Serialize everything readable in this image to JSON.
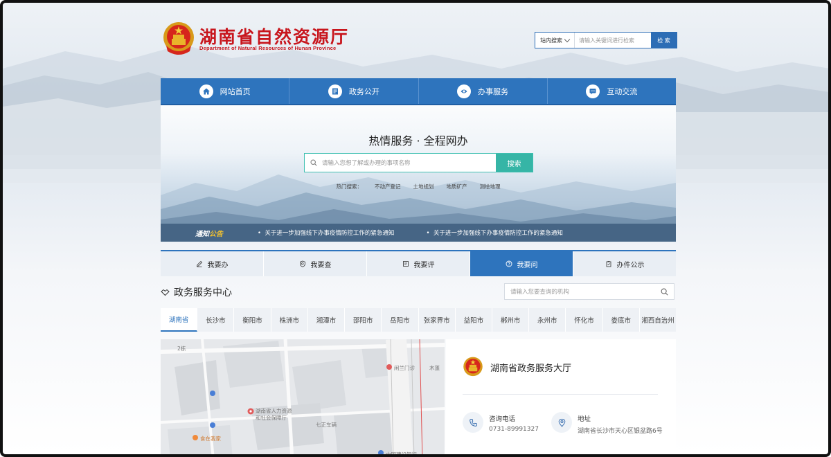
{
  "header": {
    "title": "湖南省自然资源厅",
    "subtitle": "Department of Natural Resources of Hunan Province",
    "search_scope": "站内搜索",
    "search_placeholder": "请输入关键词进行检索",
    "search_button": "检 索"
  },
  "nav": {
    "items": [
      {
        "label": "网站首页",
        "icon": "home-icon"
      },
      {
        "label": "政务公开",
        "icon": "document-icon"
      },
      {
        "label": "办事服务",
        "icon": "service-icon"
      },
      {
        "label": "互动交流",
        "icon": "chat-icon"
      }
    ]
  },
  "hero": {
    "title": "热情服务 · 全程网办",
    "search_placeholder": "请输入您想了解或办理的事项名称",
    "search_button": "搜索",
    "hot_label": "热门搜索：",
    "hot_items": [
      "不动产登记",
      "土地规划",
      "地质矿产",
      "测绘地理"
    ]
  },
  "notice": {
    "label_a": "通知",
    "label_b": "公告",
    "items": [
      "关于进一步加强线下办事疫情防控工作的紧急通知",
      "关于进一步加强线下办事疫情防控工作的紧急通知"
    ]
  },
  "service_tabs": [
    {
      "label": "我要办",
      "icon": "pen-icon"
    },
    {
      "label": "我要查",
      "icon": "shield-search-icon"
    },
    {
      "label": "我要评",
      "icon": "review-icon"
    },
    {
      "label": "我要问",
      "icon": "question-icon"
    },
    {
      "label": "办件公示",
      "icon": "clipboard-icon"
    }
  ],
  "active_service_tab": "我要问",
  "center": {
    "title": "政务服务中心",
    "search_placeholder": "请输入您要查询的机构"
  },
  "cities": [
    "湖南省",
    "长沙市",
    "衡阳市",
    "株洲市",
    "湘潭市",
    "邵阳市",
    "岳阳市",
    "张家界市",
    "益阳市",
    "郴州市",
    "永州市",
    "怀化市",
    "娄底市",
    "湘西自治州"
  ],
  "active_city": "湖南省",
  "map": {
    "labels": [
      "湖南省人力资源",
      "和社会保障厅",
      "食在我家",
      "闲兰门诊",
      "中国建设银行",
      "七正车辆",
      "木蓬",
      "2栋"
    ]
  },
  "hall": {
    "name": "湖南省政务服务大厅",
    "phone_label": "咨询电话",
    "phone": "0731-89991327",
    "address_label": "地址",
    "address": "湖南省长沙市天心区银盆路6号"
  },
  "colors": {
    "brand_red": "#c8161d",
    "nav_blue": "#2e74bd",
    "teal": "#36b5a6"
  }
}
